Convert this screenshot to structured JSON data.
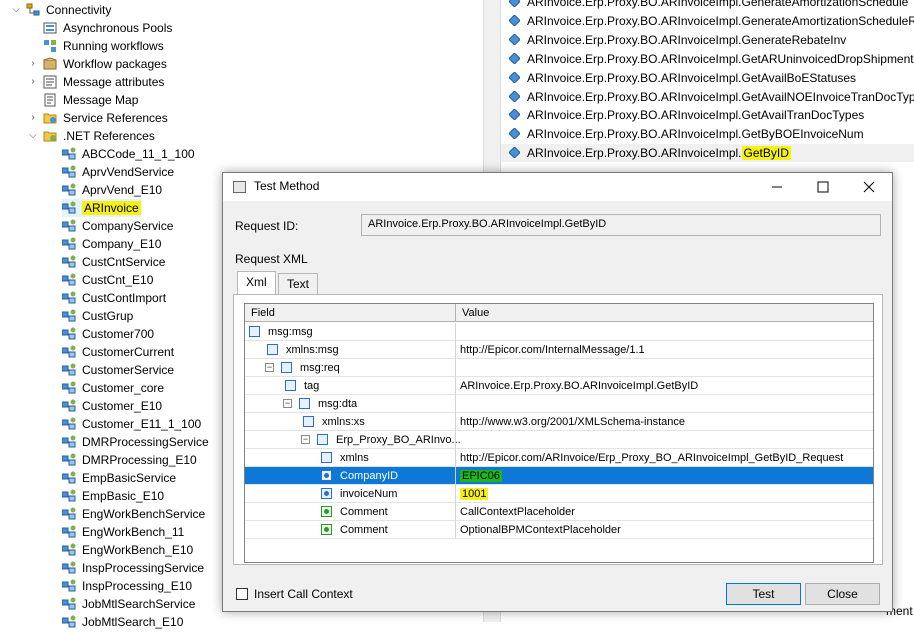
{
  "tree": {
    "items": [
      {
        "label": "Connectivity",
        "icon": "connectivity-icon",
        "expanded": true
      },
      {
        "label": "Asynchronous Pools",
        "icon": "pools-icon"
      },
      {
        "label": "Running workflows",
        "icon": "workflows-icon"
      },
      {
        "label": "Workflow packages",
        "icon": "package-icon"
      },
      {
        "label": "Message attributes",
        "icon": "attributes-icon"
      },
      {
        "label": "Message Map",
        "icon": "map-icon"
      },
      {
        "label": "Service References",
        "icon": "folder-icon"
      },
      {
        "label": ".NET References",
        "icon": "folder-icon",
        "expanded": true
      }
    ],
    "services": [
      "ABCCode_11_1_100",
      "AprvVendService",
      "AprvVend_E10",
      "ARInvoice",
      "CompanyService",
      "Company_E10",
      "CustCntService",
      "CustCnt_E10",
      "CustContImport",
      "CustGrup",
      "Customer700",
      "CustomerCurrent",
      "CustomerService",
      "Customer_core",
      "Customer_E10",
      "Customer_E11_1_100",
      "DMRProcessingService",
      "DMRProcessing_E10",
      "EmpBasicService",
      "EmpBasic_E10",
      "EngWorkBenchService",
      "EngWorkBench_11",
      "EngWorkBench_E10",
      "InspProcessingService",
      "InspProcessing_E10",
      "JobMtlSearchService",
      "JobMtlSearch_E10"
    ]
  },
  "methods": {
    "prefix": "ARInvoice.Erp.Proxy.BO.ARInvoiceImpl.",
    "items": [
      "GenerateAmortizationSchedule",
      "GenerateAmortizationScheduleRo",
      "GenerateRebateInv",
      "GetARUninvoicedDropShipments",
      "GetAvailBoEStatuses",
      "GetAvailNOEInvoiceTranDocTypes",
      "GetAvailTranDocTypes",
      "GetByBOEInvoiceNum",
      "GetByID"
    ],
    "selected": "GetByID",
    "bottom_partial": "ment"
  },
  "dialog": {
    "title": "Test Method",
    "request_id_label": "Request ID:",
    "request_id_value": "ARInvoice.Erp.Proxy.BO.ARInvoiceImpl.GetByID",
    "request_xml_label": "Request XML",
    "tabs": [
      "Xml",
      "Text"
    ],
    "columns": {
      "field": "Field",
      "value": "Value"
    },
    "rows": [
      {
        "field": "msg:msg",
        "value": ""
      },
      {
        "field": "xmlns:msg",
        "value": "http://Epicor.com/InternalMessage/1.1"
      },
      {
        "field": "msg:req",
        "value": ""
      },
      {
        "field": "tag",
        "value": "ARInvoice.Erp.Proxy.BO.ARInvoiceImpl.GetByID"
      },
      {
        "field": "msg:dta",
        "value": ""
      },
      {
        "field": "xmlns:xs",
        "value": "http://www.w3.org/2001/XMLSchema-instance"
      },
      {
        "field": "Erp_Proxy_BO_ARInvo...",
        "value": ""
      },
      {
        "field": "xmlns",
        "value": "http://Epicor.com/ARInvoice/Erp_Proxy_BO_ARInvoiceImpl_GetByID_Request"
      },
      {
        "field": "CompanyID",
        "value": "EPIC06"
      },
      {
        "field": "invoiceNum",
        "value": "1001"
      },
      {
        "field": "Comment",
        "value": "CallContextPlaceholder"
      },
      {
        "field": "Comment",
        "value": "OptionalBPMContextPlaceholder"
      }
    ],
    "insert_call_context_label": "Insert Call Context",
    "insert_call_context_checked": false,
    "test_button": "Test",
    "close_button": "Close"
  },
  "colors": {
    "highlight_yellow": "#f5f018",
    "selection_blue": "#0d78d6",
    "highlight_green": "#1bb71b"
  }
}
